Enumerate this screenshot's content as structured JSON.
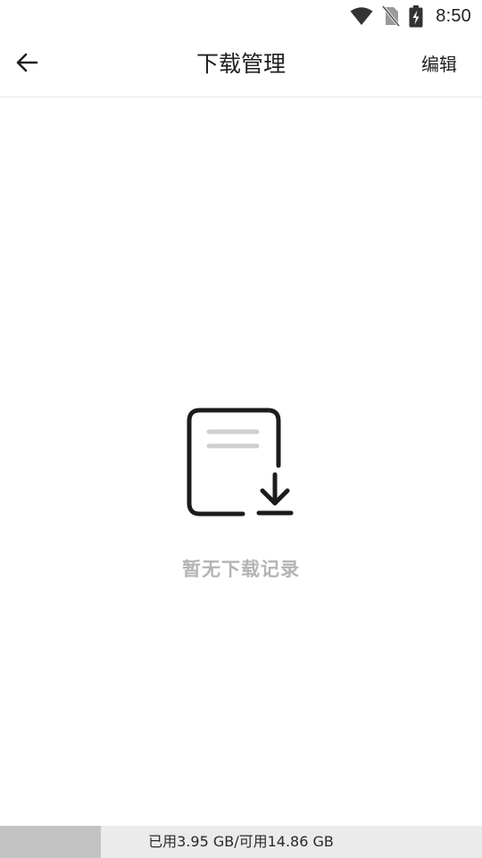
{
  "status_bar": {
    "time": "8:50",
    "icons": [
      "wifi-icon",
      "no-sim-icon",
      "battery-charging-icon"
    ]
  },
  "header": {
    "title": "下载管理",
    "back_icon": "arrow-left-icon",
    "edit_label": "编辑"
  },
  "empty_state": {
    "icon": "download-document-icon",
    "message": "暂无下载记录"
  },
  "storage": {
    "text": "已用3.95 GB/可用14.86 GB",
    "used_fraction": 0.21
  },
  "colors": {
    "empty_text": "#b4b4b4",
    "storage_track": "#ebebeb",
    "storage_fill": "#c3c3c3"
  }
}
